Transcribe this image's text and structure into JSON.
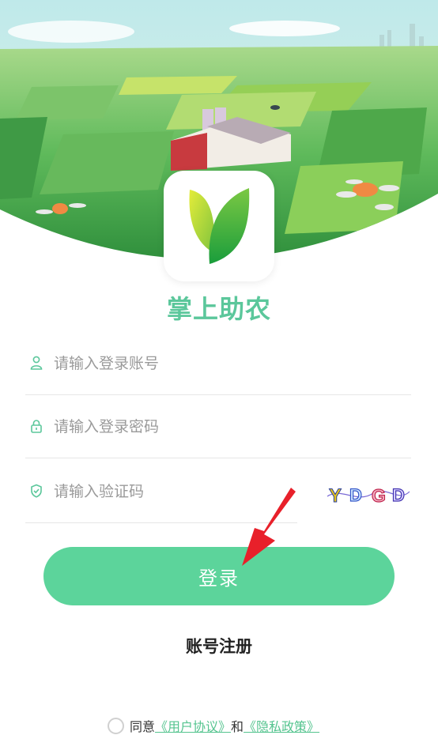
{
  "app": {
    "name": "掌上助农"
  },
  "form": {
    "account_placeholder": "请输入登录账号",
    "password_placeholder": "请输入登录密码",
    "captcha_placeholder": "请输入验证码",
    "captcha_letters": [
      "Y",
      "D",
      "G",
      "D"
    ]
  },
  "actions": {
    "login_label": "登录",
    "register_label": "账号注册"
  },
  "agreement": {
    "prefix": "同意",
    "user_agreement": "《用户协议》",
    "conjunction": "和",
    "privacy_policy": "《隐私政策》"
  },
  "colors": {
    "primary": "#5cd49b",
    "brand_text": "#5bc79b",
    "link": "#55c48f",
    "annotation": "#e8202a"
  },
  "icons": [
    "user-icon",
    "lock-icon",
    "shield-icon",
    "leaf-logo-icon"
  ]
}
